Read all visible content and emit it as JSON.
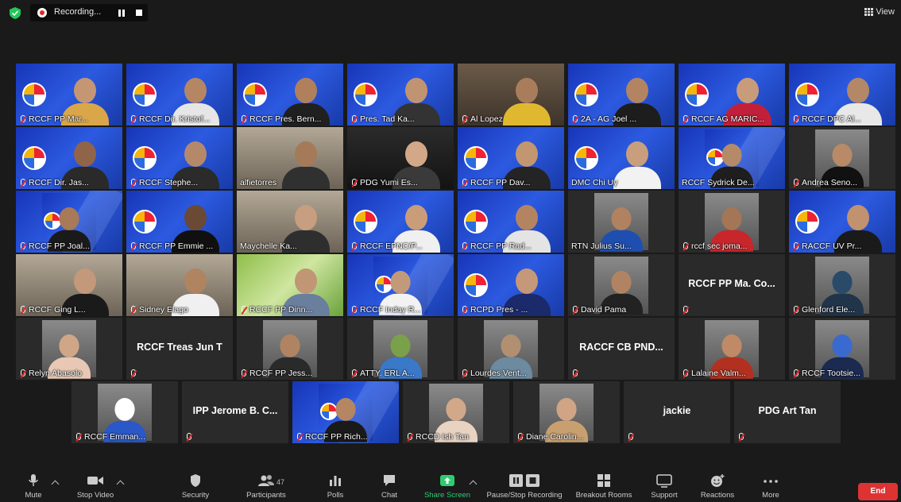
{
  "recording": {
    "label": "Recording..."
  },
  "view": {
    "label": "View"
  },
  "participants": [
    {
      "name": "RCCF PP Mar...",
      "style": "blue",
      "skin": "#c49674",
      "shirt": "#d9a64a",
      "muted": true
    },
    {
      "name": "RCCF Dir. Kristof...",
      "style": "blue",
      "skin": "#b48664",
      "shirt": "#e6e6e6",
      "muted": true,
      "active": true
    },
    {
      "name": "RCCF Pres. Bern...",
      "style": "blue",
      "skin": "#b0805c",
      "shirt": "#202020",
      "muted": true
    },
    {
      "name": "Pres. Tad Ka...",
      "style": "blue",
      "skin": "#c09472",
      "shirt": "#333333",
      "muted": true
    },
    {
      "name": "Al Lopez",
      "style": "warm",
      "skin": "#a97d5c",
      "shirt": "#e0b830",
      "muted": true
    },
    {
      "name": "2A - AG Joel ...",
      "style": "blue",
      "skin": "#b38462",
      "shirt": "#1d1d1d",
      "muted": true
    },
    {
      "name": "RCCF AG MARIC...",
      "style": "blue",
      "skin": "#c89c7a",
      "shirt": "#c2203a",
      "muted": true
    },
    {
      "name": "RCCF DPC Al...",
      "style": "blue",
      "skin": "#b48766",
      "shirt": "#e8e8e8",
      "muted": true
    },
    {
      "name": "RCCF Dir. Jas...",
      "style": "blue",
      "skin": "#8f6448",
      "shirt": "#2a2a2a",
      "muted": true
    },
    {
      "name": "RCCF Stephe...",
      "style": "blue",
      "skin": "#b6886a",
      "shirt": "#2b2b2b",
      "muted": true
    },
    {
      "name": "alfietorres",
      "style": "room",
      "skin": "#a47a58",
      "shirt": "#303030",
      "muted": false
    },
    {
      "name": "PDG Yumi Es...",
      "style": "night",
      "skin": "#d2a888",
      "shirt": "#3a3a3a",
      "muted": true
    },
    {
      "name": "RCCF PP Dav...",
      "style": "blue",
      "skin": "#c29670",
      "shirt": "#242424",
      "muted": true
    },
    {
      "name": "DMC Chi Uy",
      "style": "blue",
      "skin": "#c89e7c",
      "shirt": "#f2f2f2",
      "muted": false
    },
    {
      "name": "RCCF Sydrick De...",
      "style": "bluesmall",
      "skin": "#b48a68",
      "shirt": "#1e1e1e",
      "muted": false
    },
    {
      "name": "Andrea Seno...",
      "style": "darksmall",
      "skin": "#b88a68",
      "shirt": "#111111",
      "muted": true
    },
    {
      "name": "RCCF PP Joal...",
      "style": "bluesmall",
      "skin": "#a87a58",
      "shirt": "#1a1a1a",
      "muted": true
    },
    {
      "name": "RCCF PP Emmie ...",
      "style": "blue",
      "skin": "#6a4a34",
      "shirt": "#101010",
      "muted": true
    },
    {
      "name": "Maychelle Ka...",
      "style": "room",
      "skin": "#c79e80",
      "shirt": "#2e2e2e",
      "muted": false
    },
    {
      "name": "RCCF EPNC/P...",
      "style": "blue",
      "skin": "#c99c7a",
      "shirt": "#f0f0f0",
      "muted": true
    },
    {
      "name": "RCCF PP Rad...",
      "style": "blue",
      "skin": "#b48462",
      "shirt": "#e4e4e4",
      "muted": true
    },
    {
      "name": "RTN Julius Su...",
      "style": "darksmall",
      "skin": "#b08260",
      "shirt": "#1e4fb0",
      "muted": false
    },
    {
      "name": "rccf sec joma...",
      "style": "darksmall",
      "skin": "#a47656",
      "shirt": "#c8262a",
      "muted": true
    },
    {
      "name": "RACCF UV Pr...",
      "style": "blue",
      "skin": "#c09270",
      "shirt": "#1a1a1a",
      "muted": true
    },
    {
      "name": "RCCF Ging L...",
      "style": "room",
      "skin": "#c4987a",
      "shirt": "#1a1a1a",
      "muted": true
    },
    {
      "name": "Sidney Elago",
      "style": "room",
      "skin": "#b08460",
      "shirt": "#f0f0f0",
      "muted": true
    },
    {
      "name": "RCCF PP Dinn...",
      "style": "green",
      "skin": "#c09674",
      "shirt": "#6a7e9e",
      "muted": true
    },
    {
      "name": "RCCF Inday R...",
      "style": "bluesmall",
      "skin": "#c29a7a",
      "shirt": "#f2f2f2",
      "muted": true
    },
    {
      "name": "RCPD Pres - ...",
      "style": "blue",
      "skin": "#c49878",
      "shirt": "#1a2a6a",
      "muted": true
    },
    {
      "name": "David Pama",
      "style": "darksmall",
      "skin": "#b08462",
      "shirt": "#222222",
      "muted": true
    },
    {
      "name": "RCCF PP Ma. Co...",
      "style": "textonly",
      "muted": true
    },
    {
      "name": "Glenford Ele...",
      "style": "darksmall",
      "skin": "#2a4a6a",
      "shirt": "#20344a",
      "muted": true
    },
    {
      "name": "Relyn Abasolo",
      "style": "darksmall",
      "skin": "#d0a688",
      "shirt": "#e8c8b4",
      "muted": true
    },
    {
      "name": "RCCF Treas Jun T",
      "style": "textonly",
      "muted": true
    },
    {
      "name": "RCCF PP Jess...",
      "style": "darksmall",
      "skin": "#b08462",
      "shirt": "#2a2a2a",
      "muted": true
    },
    {
      "name": "ATTY. ERL A...",
      "style": "darksmall",
      "skin": "#7aa04a",
      "shirt": "#3a78c8",
      "muted": true
    },
    {
      "name": "Lourdes Vent...",
      "style": "darksmall",
      "skin": "#b09070",
      "shirt": "#6c8aa0",
      "muted": true
    },
    {
      "name": "RACCF CB PND...",
      "style": "textonly",
      "muted": true
    },
    {
      "name": "Lalaine Valm...",
      "style": "darksmall",
      "skin": "#c08a66",
      "shirt": "#b23020",
      "muted": true
    },
    {
      "name": "RCCF Tootsie...",
      "style": "darksmall",
      "skin": "#3a6ad0",
      "shirt": "#1a2a50",
      "muted": true
    },
    {
      "name": "RCCF Emman...",
      "style": "darksmall",
      "skin": "#ffffff",
      "shirt": "#2a58c8",
      "muted": true
    },
    {
      "name": "IPP Jerome B. C...",
      "style": "textonly",
      "muted": true
    },
    {
      "name": "RCCF PP Rich...",
      "style": "bluesmall",
      "skin": "#b48664",
      "shirt": "#1a1a1a",
      "muted": true
    },
    {
      "name": "RCCD Ish Tan",
      "style": "darksmall",
      "skin": "#d2a88a",
      "shirt": "#e8d2c2",
      "muted": true
    },
    {
      "name": "Diane Carolin...",
      "style": "darksmall",
      "skin": "#d0a484",
      "shirt": "#c8a070",
      "muted": true
    },
    {
      "name": "jackie",
      "style": "textonly",
      "muted": true
    },
    {
      "name": "PDG Art Tan",
      "style": "textonly",
      "muted": true
    }
  ],
  "toolbar": {
    "mute": "Mute",
    "stop_video": "Stop Video",
    "security": "Security",
    "participants": "Participants",
    "participants_count": "47",
    "polls": "Polls",
    "chat": "Chat",
    "share_screen": "Share Screen",
    "recording": "Pause/Stop Recording",
    "breakout": "Breakout Rooms",
    "support": "Support",
    "reactions": "Reactions",
    "more": "More",
    "end": "End"
  },
  "colors": {
    "share_green": "#2ecc71",
    "end_red": "#d33333",
    "active_outline": "#d8d440"
  }
}
